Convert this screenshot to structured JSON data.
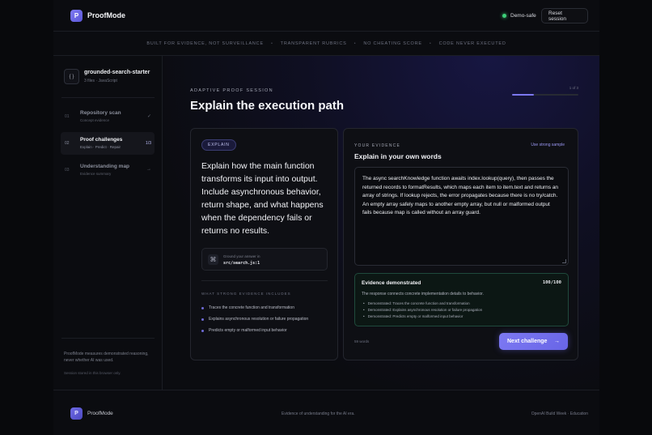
{
  "header": {
    "logo_letter": "P",
    "brand": "ProofMode",
    "demo_label": "Demo-safe",
    "reset_label": "Reset session"
  },
  "ticker": [
    "BUILT FOR EVIDENCE, NOT SURVEILLANCE",
    "TRANSPARENT RUBRICS",
    "NO CHEATING SCORE",
    "CODE NEVER EXECUTED"
  ],
  "sidebar": {
    "repo_icon": "{ }",
    "repo_name": "grounded-search-starter",
    "repo_meta": "3 files · JavaScript",
    "steps": [
      {
        "num": "01",
        "title": "Repository scan",
        "sub": "Concept evidence",
        "mark": "✓"
      },
      {
        "num": "02",
        "title": "Proof challenges",
        "sub": "Explain · Predict · Repair",
        "mark": "1/3"
      },
      {
        "num": "03",
        "title": "Understanding map",
        "sub": "Evidence summary",
        "mark": "→"
      }
    ],
    "note": "ProofMode measures demonstrated reasoning, never whether AI was used.",
    "session": "Session stored in this browser only."
  },
  "main": {
    "eyebrow": "ADAPTIVE PROOF SESSION",
    "title": "Explain the execution path",
    "progress_label": "1 of 3",
    "progress": 0.333
  },
  "question_card": {
    "tag": "EXPLAIN",
    "question": "Explain how the main function transforms its input into output. Include asynchronous behavior, return shape, and what happens when the dependency fails or returns no results.",
    "hint_label": "Ground your answer in",
    "hint_path": "src/search.js:1",
    "evidence_heading": "WHAT STRONG EVIDENCE INCLUDES",
    "evidence_items": [
      "Traces the concrete function and transformation",
      "Explains asynchronous resolution or failure propagation",
      "Predicts empty or malformed input behavior"
    ]
  },
  "answer_card": {
    "eyebrow": "YOUR EVIDENCE",
    "sample_link": "Use strong sample",
    "title": "Explain in your own words",
    "answer": "The async searchKnowledge function awaits index.lookup(query), then passes the returned records to formatResults, which maps each item to item.text and returns an array of strings. If lookup rejects, the error propagates because there is no try/catch. An empty array safely maps to another empty array, but null or malformed output fails because map is called without an array guard.",
    "result_title": "Evidence demonstrated",
    "score": "100/100",
    "result_desc": "The response connects concrete implementation details to behavior.",
    "result_items": [
      "Demonstrated: Traces the concrete function and transformation",
      "Demonstrated: Explains asynchronous resolution or failure propagation",
      "Demonstrated: Predicts empty or malformed input behavior"
    ],
    "word_count": "59 words",
    "next_label": "Next challenge",
    "next_arrow": "→"
  },
  "footer": {
    "logo_letter": "P",
    "brand": "ProofMode",
    "center": "Evidence of understanding for the AI era.",
    "right": "OpenAI Build Week · Education"
  },
  "colors": {
    "accent": "#7c78f0",
    "success": "#3ccf78",
    "background": "#0b0c10"
  }
}
